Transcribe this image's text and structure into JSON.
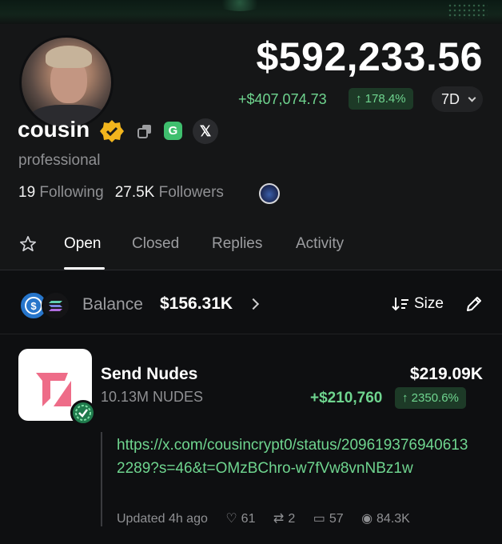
{
  "profile": {
    "name": "cousin",
    "bio": "professional",
    "following_count": "19",
    "following_label": "Following",
    "followers_count": "27.5K",
    "followers_label": "Followers"
  },
  "portfolio": {
    "total_value": "$592,233.56",
    "pnl_abs": "+$407,074.73",
    "pnl_pct": "↑ 178.4%",
    "period": "7D"
  },
  "tabs": [
    {
      "label": "Open",
      "active": true
    },
    {
      "label": "Closed",
      "active": false
    },
    {
      "label": "Replies",
      "active": false
    },
    {
      "label": "Activity",
      "active": false
    }
  ],
  "balance_row": {
    "label": "Balance",
    "value": "$156.31K",
    "sort_label": "Size"
  },
  "position": {
    "name": "Send Nudes",
    "quantity": "10.13M NUDES",
    "value": "$219.09K",
    "pnl_abs": "+$210,760",
    "pnl_pct": "↑ 2350.6%",
    "post": {
      "link": "https://x.com/cousincrypt0/status/2096193769406132289?s=46&t=OMzBChro-w7fVw8vnNBz1w",
      "updated": "Updated 4h ago",
      "likes": "61",
      "reposts": "2",
      "comments": "57",
      "views": "84.3K"
    }
  },
  "colors": {
    "background": "#0e0f11",
    "header_bg": "#151617",
    "accent_green": "#6fd58f",
    "green_chip_bg": "#1d3a27",
    "verified_gold": "#f2b51d"
  },
  "icons": [
    "verified-badge-icon",
    "copy-icon",
    "g-app-icon",
    "x-icon",
    "star-icon",
    "usdc-icon",
    "sol-icon",
    "sort-icon",
    "pencil-icon",
    "heart-icon",
    "repost-icon",
    "comment-icon",
    "eye-icon"
  ]
}
